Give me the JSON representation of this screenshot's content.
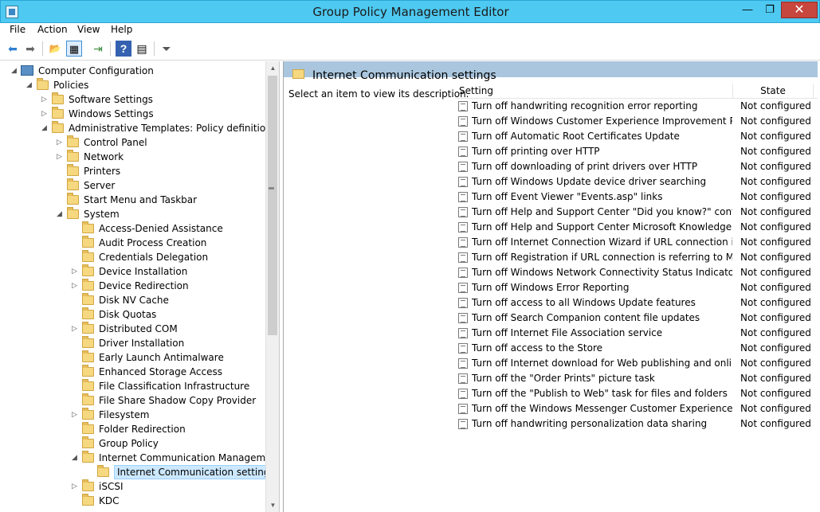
{
  "window": {
    "title": "Group Policy Management Editor",
    "controls": {
      "minimize": "—",
      "maximize": "❐",
      "close": "✕"
    }
  },
  "menu": [
    "File",
    "Action",
    "View",
    "Help"
  ],
  "toolbar": {
    "buttons": [
      "back-icon",
      "forward-icon",
      "up-folder-icon",
      "show-hide-tree-icon",
      "export-icon",
      "help-icon",
      "properties-icon",
      "filter-icon"
    ],
    "glyphs": [
      "⬅",
      "➡",
      "📂",
      "▦",
      "⇥",
      "?",
      "▤",
      "⏷"
    ]
  },
  "tree": {
    "items": [
      {
        "label": "Computer Configuration",
        "expander": "◢",
        "icon": "computer"
      },
      {
        "label": "Policies",
        "expander": "◢",
        "icon": "folder"
      },
      {
        "label": "Software Settings",
        "expander": "▷",
        "icon": "folder"
      },
      {
        "label": "Windows Settings",
        "expander": "▷",
        "icon": "folder"
      },
      {
        "label": "Administrative Templates: Policy definitions (A",
        "expander": "◢",
        "icon": "folder"
      },
      {
        "label": "Control Panel",
        "expander": "▷",
        "icon": "folder"
      },
      {
        "label": "Network",
        "expander": "▷",
        "icon": "folder"
      },
      {
        "label": "Printers",
        "expander": "",
        "icon": "folder"
      },
      {
        "label": "Server",
        "expander": "",
        "icon": "folder"
      },
      {
        "label": "Start Menu and Taskbar",
        "expander": "",
        "icon": "folder"
      },
      {
        "label": "System",
        "expander": "◢",
        "icon": "folder"
      },
      {
        "label": "Access-Denied Assistance",
        "expander": "",
        "icon": "folder"
      },
      {
        "label": "Audit Process Creation",
        "expander": "",
        "icon": "folder"
      },
      {
        "label": "Credentials Delegation",
        "expander": "",
        "icon": "folder"
      },
      {
        "label": "Device Installation",
        "expander": "▷",
        "icon": "folder"
      },
      {
        "label": "Device Redirection",
        "expander": "▷",
        "icon": "folder"
      },
      {
        "label": "Disk NV Cache",
        "expander": "",
        "icon": "folder"
      },
      {
        "label": "Disk Quotas",
        "expander": "",
        "icon": "folder"
      },
      {
        "label": "Distributed COM",
        "expander": "▷",
        "icon": "folder"
      },
      {
        "label": "Driver Installation",
        "expander": "",
        "icon": "folder"
      },
      {
        "label": "Early Launch Antimalware",
        "expander": "",
        "icon": "folder"
      },
      {
        "label": "Enhanced Storage Access",
        "expander": "",
        "icon": "folder"
      },
      {
        "label": "File Classification Infrastructure",
        "expander": "",
        "icon": "folder"
      },
      {
        "label": "File Share Shadow Copy Provider",
        "expander": "",
        "icon": "folder"
      },
      {
        "label": "Filesystem",
        "expander": "▷",
        "icon": "folder"
      },
      {
        "label": "Folder Redirection",
        "expander": "",
        "icon": "folder"
      },
      {
        "label": "Group Policy",
        "expander": "",
        "icon": "folder"
      },
      {
        "label": "Internet Communication Management",
        "expander": "◢",
        "icon": "folder"
      },
      {
        "label": "Internet Communication settings",
        "expander": "",
        "icon": "folder",
        "selected": true
      },
      {
        "label": "iSCSI",
        "expander": "▷",
        "icon": "folder"
      },
      {
        "label": "KDC",
        "expander": "",
        "icon": "folder"
      }
    ]
  },
  "scrollbar": {
    "up": "▲",
    "down": "▼"
  },
  "details": {
    "header": "Internet Communication settings",
    "description": "Select an item to view its description.",
    "columns": {
      "setting": "Setting",
      "state": "State"
    },
    "rows": [
      {
        "setting": "Turn off handwriting recognition error reporting",
        "state": "Not configured"
      },
      {
        "setting": "Turn off Windows Customer Experience Improvement Progr...",
        "state": "Not configured"
      },
      {
        "setting": "Turn off Automatic Root Certificates Update",
        "state": "Not configured"
      },
      {
        "setting": "Turn off printing over HTTP",
        "state": "Not configured"
      },
      {
        "setting": "Turn off downloading of print drivers over HTTP",
        "state": "Not configured"
      },
      {
        "setting": "Turn off Windows Update device driver searching",
        "state": "Not configured"
      },
      {
        "setting": "Turn off Event Viewer \"Events.asp\" links",
        "state": "Not configured"
      },
      {
        "setting": "Turn off Help and Support Center \"Did you know?\" content",
        "state": "Not configured"
      },
      {
        "setting": "Turn off Help and Support Center Microsoft Knowledge Bas...",
        "state": "Not configured"
      },
      {
        "setting": "Turn off Internet Connection Wizard if URL connection is ref...",
        "state": "Not configured"
      },
      {
        "setting": "Turn off Registration if URL connection is referring to Micro...",
        "state": "Not configured"
      },
      {
        "setting": "Turn off Windows Network Connectivity Status Indicator act...",
        "state": "Not configured"
      },
      {
        "setting": "Turn off Windows Error Reporting",
        "state": "Not configured"
      },
      {
        "setting": "Turn off access to all Windows Update features",
        "state": "Not configured"
      },
      {
        "setting": "Turn off Search Companion content file updates",
        "state": "Not configured"
      },
      {
        "setting": "Turn off Internet File Association service",
        "state": "Not configured"
      },
      {
        "setting": "Turn off access to the Store",
        "state": "Not configured"
      },
      {
        "setting": "Turn off Internet download for Web publishing and online o...",
        "state": "Not configured"
      },
      {
        "setting": "Turn off the \"Order Prints\" picture task",
        "state": "Not configured"
      },
      {
        "setting": "Turn off the \"Publish to Web\" task for files and folders",
        "state": "Not configured"
      },
      {
        "setting": "Turn off the Windows Messenger Customer Experience Impr...",
        "state": "Not configured"
      },
      {
        "setting": "Turn off handwriting personalization data sharing",
        "state": "Not configured"
      }
    ]
  }
}
